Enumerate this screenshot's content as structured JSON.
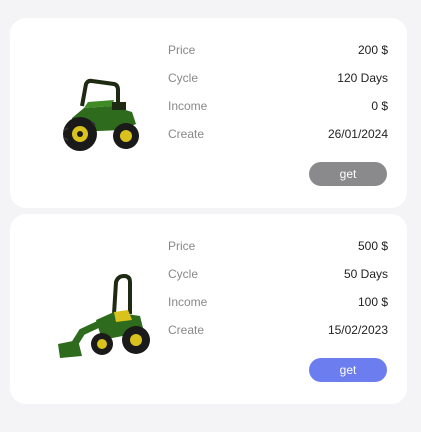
{
  "products": [
    {
      "image": "tractor-icon",
      "rows": [
        {
          "label": "Price",
          "value": "200 $"
        },
        {
          "label": "Cycle",
          "value": "120 Days"
        },
        {
          "label": "Income",
          "value": "0 $"
        },
        {
          "label": "Create",
          "value": "26/01/2024"
        }
      ],
      "button_label": "get",
      "button_color": "#8a8a8c"
    },
    {
      "image": "tractor-loader-icon",
      "rows": [
        {
          "label": "Price",
          "value": "500 $"
        },
        {
          "label": "Cycle",
          "value": "50 Days"
        },
        {
          "label": "Income",
          "value": "100 $"
        },
        {
          "label": "Create",
          "value": "15/02/2023"
        }
      ],
      "button_label": "get",
      "button_color": "#6c7df0"
    }
  ]
}
